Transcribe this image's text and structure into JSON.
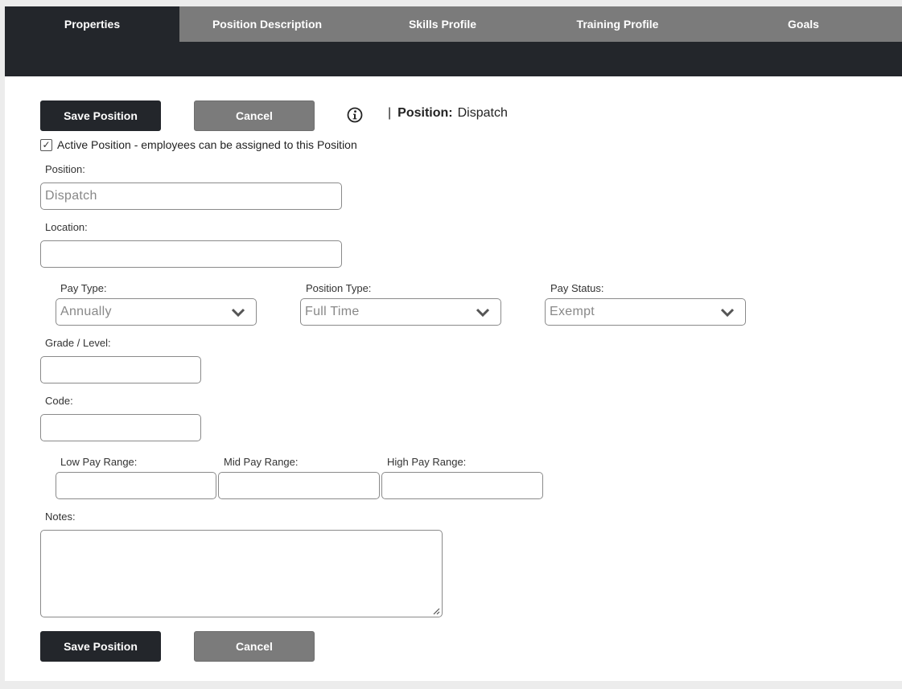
{
  "tabs": [
    {
      "label": "Properties",
      "active": true
    },
    {
      "label": "Position Description",
      "active": false
    },
    {
      "label": "Skills Profile",
      "active": false
    },
    {
      "label": "Training Profile",
      "active": false
    },
    {
      "label": "Goals",
      "active": false
    }
  ],
  "toolbar": {
    "save_label": "Save Position",
    "cancel_label": "Cancel",
    "separator": "|",
    "position_label": "Position:",
    "position_value": "Dispatch"
  },
  "active_checkbox": {
    "checked": true,
    "glyph": "✓",
    "label": "Active Position - employees can be assigned to this Position"
  },
  "form": {
    "position": {
      "label": "Position:",
      "value": "Dispatch"
    },
    "location": {
      "label": "Location:",
      "value": ""
    },
    "pay_type": {
      "label": "Pay Type:",
      "value": "Annually"
    },
    "position_type": {
      "label": "Position Type:",
      "value": "Full Time"
    },
    "pay_status": {
      "label": "Pay Status:",
      "value": "Exempt"
    },
    "grade_level": {
      "label": "Grade / Level:",
      "value": ""
    },
    "code": {
      "label": "Code:",
      "value": ""
    },
    "low_pay": {
      "label": "Low Pay Range:",
      "value": ""
    },
    "mid_pay": {
      "label": "Mid Pay Range:",
      "value": ""
    },
    "high_pay": {
      "label": "High Pay Range:",
      "value": ""
    },
    "notes": {
      "label": "Notes:",
      "value": ""
    }
  },
  "footer": {
    "save_label": "Save Position",
    "cancel_label": "Cancel"
  },
  "colors": {
    "dark": "#23262b",
    "tab_gray": "#7b7b7b",
    "page_bg": "#ececec"
  },
  "icons": {
    "info": "info-circle-icon",
    "chevron": "chevron-down-icon",
    "checkbox": "checkmark-icon"
  }
}
